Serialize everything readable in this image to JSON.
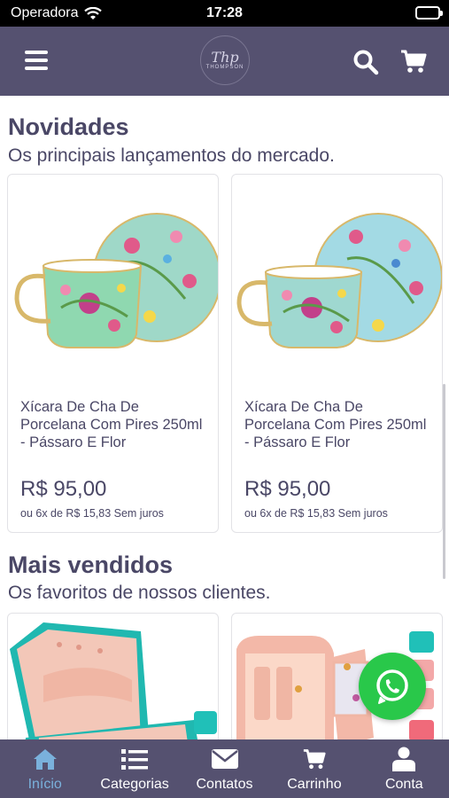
{
  "status_bar": {
    "carrier": "Operadora",
    "time": "17:28"
  },
  "header": {
    "logo_mark": "Thp",
    "logo_text": "THOMPSON",
    "icons": [
      "menu-icon",
      "search-icon",
      "cart-icon"
    ]
  },
  "sections": {
    "new": {
      "title": "Novidades",
      "subtitle": "Os principais lançamentos do mercado."
    },
    "best": {
      "title": "Mais vendidos",
      "subtitle": "Os favoritos de nossos clientes."
    }
  },
  "products_new": [
    {
      "name": "Xícara De Cha De Porcelana Com Pires 250ml - Pássaro E Flor",
      "price": "R$ 95,00",
      "installments": "ou 6x de R$ 15,83 Sem juros"
    },
    {
      "name": "Xícara De Cha De Porcelana Com Pires 250ml - Pássaro E Flor",
      "price": "R$ 95,00",
      "installments": "ou 6x de R$ 15,83 Sem juros"
    }
  ],
  "bottom_nav": [
    {
      "label": "Início",
      "icon": "home-icon",
      "active": true
    },
    {
      "label": "Categorias",
      "icon": "list-icon",
      "active": false
    },
    {
      "label": "Contatos",
      "icon": "envelope-icon",
      "active": false
    },
    {
      "label": "Carrinho",
      "icon": "cart-icon",
      "active": false
    },
    {
      "label": "Conta",
      "icon": "user-icon",
      "active": false
    }
  ],
  "colors": {
    "brand": "#555170",
    "active_nav": "#7ab1dc",
    "whatsapp": "#29c84a",
    "text": "#4a4766"
  }
}
